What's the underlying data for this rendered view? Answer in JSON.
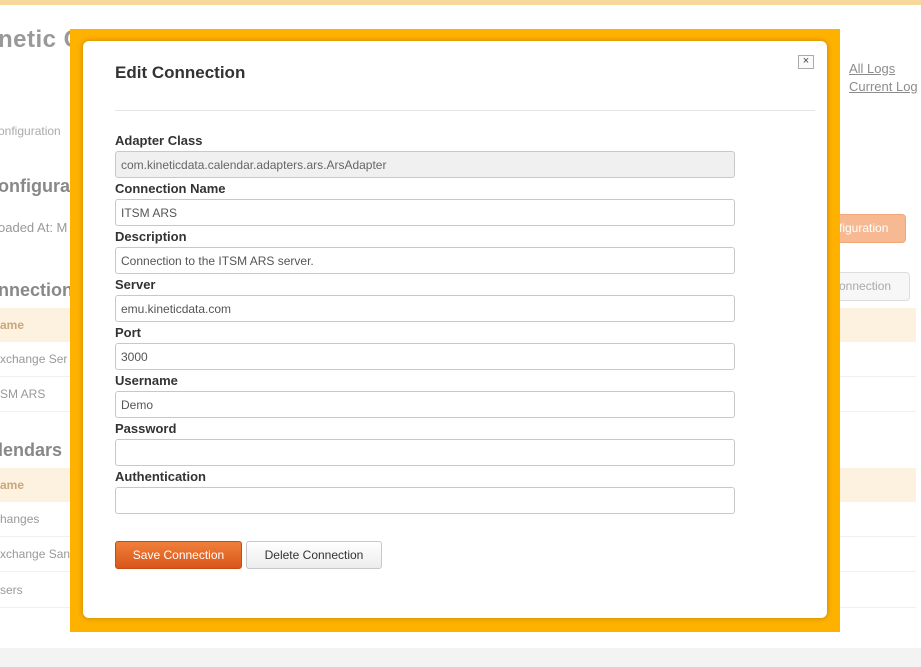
{
  "background": {
    "app_title": "netic C",
    "top_links": [
      "All Logs",
      "Current Log"
    ],
    "breadcrumb": "onfiguration",
    "configuration_title": "onfigurati",
    "loaded_at": "oaded At: M",
    "configuration_button": "figuration",
    "connections_title": "nnection",
    "new_connection_button": "onnection",
    "connections_header": "ame",
    "connections_rows": [
      "xchange Ser",
      "SM ARS"
    ],
    "calendars_title": "lendars",
    "calendars_header": "ame",
    "calendars_rows": [
      "hanges",
      "xchange San",
      "sers"
    ]
  },
  "modal": {
    "title": "Edit Connection",
    "close_label": "×",
    "fields": {
      "adapter_class": {
        "label": "Adapter Class",
        "value": "com.kineticdata.calendar.adapters.ars.ArsAdapter"
      },
      "connection_name": {
        "label": "Connection Name",
        "value": "ITSM ARS"
      },
      "description": {
        "label": "Description",
        "value": "Connection to the ITSM ARS server."
      },
      "server": {
        "label": "Server",
        "value": "emu.kineticdata.com"
      },
      "port": {
        "label": "Port",
        "value": "3000"
      },
      "username": {
        "label": "Username",
        "value": "Demo"
      },
      "password": {
        "label": "Password",
        "value": ""
      },
      "authentication": {
        "label": "Authentication",
        "value": ""
      }
    },
    "save_label": "Save Connection",
    "delete_label": "Delete Connection"
  },
  "colors": {
    "overlay_frame": "#ffb100",
    "save_button": "#e2672a",
    "table_header_bg": "#fdf1df"
  }
}
